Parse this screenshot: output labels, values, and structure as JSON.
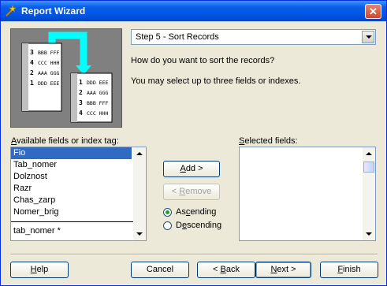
{
  "window": {
    "title": "Report Wizard",
    "close_glyph": "✕"
  },
  "step_select": {
    "value": "Step 5 - Sort Records"
  },
  "prompt": {
    "question": "How do you want to sort the records?",
    "hint": "You may select up to three fields or indexes."
  },
  "available": {
    "label_prefix": "",
    "label_accel": "A",
    "label_rest": "vailable fields or index tag:",
    "fields": [
      "Fio",
      "Tab_nomer",
      "Dolznost",
      "Razr",
      "Chas_zarp",
      "Nomer_brig"
    ],
    "selected_index": 0,
    "index_tag": "tab_nomer *"
  },
  "selected": {
    "label_prefix": "",
    "label_accel": "S",
    "label_rest": "elected fields:"
  },
  "buttons": {
    "add": {
      "prefix": "",
      "accel": "A",
      "rest": "dd >"
    },
    "remove": {
      "prefix": "< ",
      "accel": "R",
      "rest": "emove"
    },
    "help": {
      "prefix": "",
      "accel": "H",
      "rest": "elp"
    },
    "cancel": {
      "label": "Cancel"
    },
    "back": {
      "prefix": "< ",
      "accel": "B",
      "rest": "ack"
    },
    "next": {
      "prefix": "",
      "accel": "N",
      "rest": "ext >"
    },
    "finish": {
      "prefix": "",
      "accel": "F",
      "rest": "inish"
    }
  },
  "order": {
    "ascending": {
      "prefix": "As",
      "accel": "c",
      "rest": "ending",
      "checked": true
    },
    "descending": {
      "prefix": "D",
      "accel": "e",
      "rest": "scending",
      "checked": false
    }
  },
  "illustration": {
    "back_rows": [
      [
        "3",
        "BBB FFF"
      ],
      [
        "4",
        "CCC HHH"
      ],
      [
        "2",
        "AAA GGG"
      ],
      [
        "1",
        "DDD EEE"
      ]
    ],
    "front_rows": [
      [
        "1",
        "DDD EEE"
      ],
      [
        "2",
        "AAA GGG"
      ],
      [
        "3",
        "BBB FFF"
      ],
      [
        "4",
        "CCC HHH"
      ]
    ],
    "accent_color": "#00ffff"
  }
}
